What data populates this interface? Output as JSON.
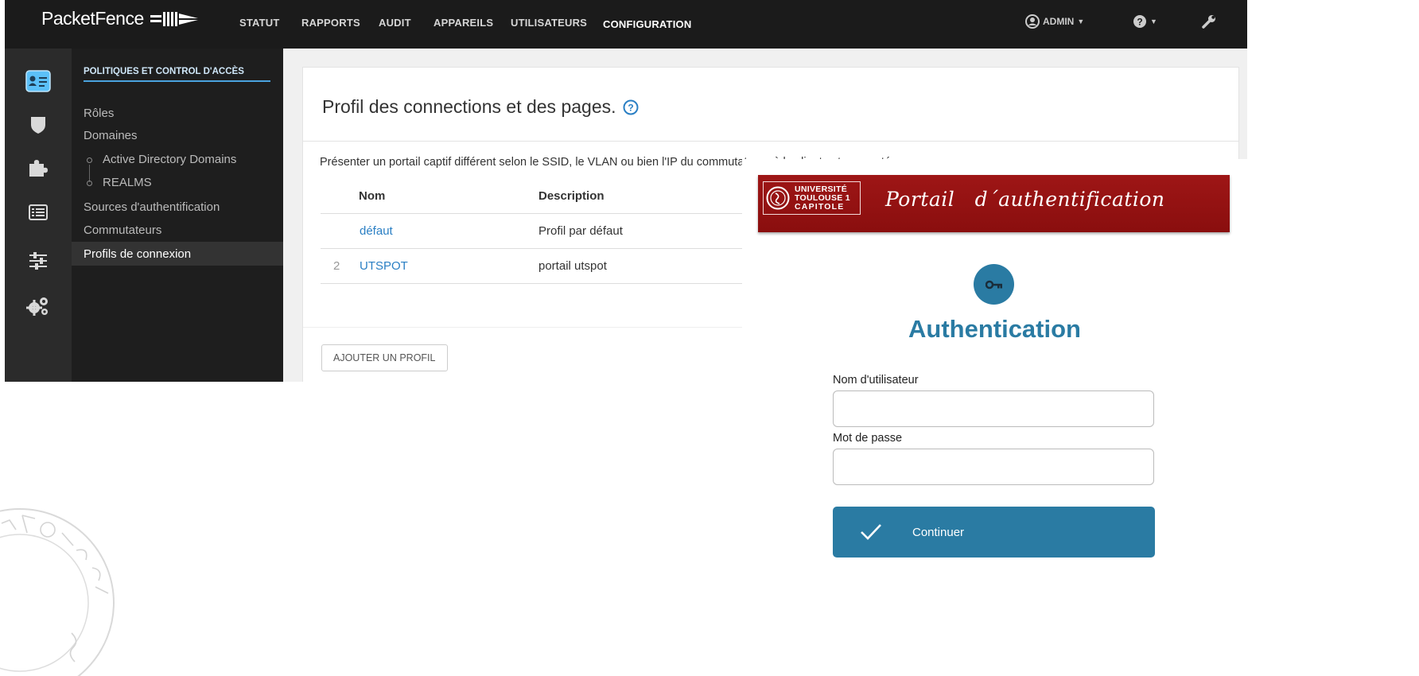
{
  "admin": {
    "logo_text": "PacketFence",
    "nav": [
      "STATUT",
      "RAPPORTS",
      "AUDIT",
      "APPAREILS",
      "UTILISATEURS",
      "CONFIGURATION"
    ],
    "active_nav": "CONFIGURATION",
    "user_menu": "ADMIN",
    "icons": [
      "id-card-icon",
      "shield-icon",
      "puzzle-icon",
      "list-icon",
      "sliders-icon",
      "gears-icon",
      "user-icon",
      "help-icon",
      "wrench-icon"
    ],
    "submenu": {
      "title": "POLITIQUES ET CONTROL D'ACCÈS",
      "items": [
        "Rôles",
        "Domaines",
        "Active Directory Domains",
        "REALMS",
        "Sources d'authentification",
        "Commutateurs",
        "Profils de connexion"
      ],
      "active": "Profils de connexion"
    },
    "content": {
      "title": "Profil des connections et des pages.",
      "description": "Présenter un portail captif différent selon le SSID, le VLAN ou bien l'IP du commutateur où le client est connecté",
      "columns": [
        "Nom",
        "Description"
      ],
      "rows": [
        {
          "index": "",
          "name": "défaut",
          "description": "Profil par défaut"
        },
        {
          "index": "2",
          "name": "UTSPOT",
          "description": "portail utspot"
        }
      ],
      "add_button": "AJOUTER UN PROFIL"
    }
  },
  "portal": {
    "banner_logo": [
      "UNIVERSITÉ",
      "TOULOUSE 1",
      "CAPITOLE"
    ],
    "banner_title": "Portail   d´authentification",
    "heading": "Authentication",
    "username_label": "Nom d'utilisateur",
    "password_label": "Mot de passe",
    "continue_label": "Continuer"
  },
  "colors": {
    "topbar": "#1b1b1b",
    "accent_blue": "#4aa3df",
    "link": "#2a7fc4",
    "portal_teal": "#2a7ba3",
    "banner_red": "#9e1616"
  }
}
